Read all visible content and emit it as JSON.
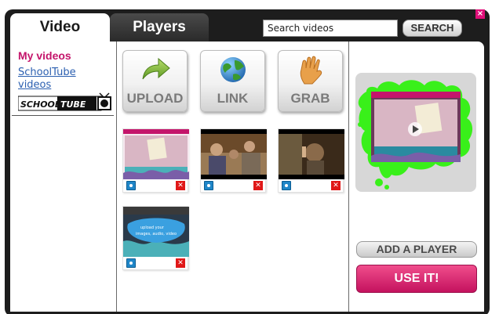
{
  "tabs": [
    {
      "label": "Video",
      "active": true
    },
    {
      "label": "Players",
      "active": false
    }
  ],
  "search": {
    "value": "Search videos",
    "button_label": "SEARCH"
  },
  "sidebar": {
    "heading": "My videos",
    "link": "SchoolTube videos",
    "logo_text": "SCHOOLTUBE"
  },
  "actions": [
    {
      "label": "UPLOAD",
      "icon": "arrow-icon"
    },
    {
      "label": "LINK",
      "icon": "globe-icon"
    },
    {
      "label": "GRAB",
      "icon": "hand-icon"
    }
  ],
  "thumbnails": [
    {
      "kind": "schooltube-page"
    },
    {
      "kind": "classroom-scene"
    },
    {
      "kind": "dark-scene"
    },
    {
      "kind": "upload-slide",
      "caption": "upload your images, audio, video"
    }
  ],
  "right": {
    "add_player_label": "ADD A PLAYER",
    "use_it_label": "USE IT!"
  },
  "colors": {
    "accent": "#c4156b",
    "link": "#2b5fb0",
    "frame": "#1d1d1d",
    "splash": "#39f01a"
  }
}
